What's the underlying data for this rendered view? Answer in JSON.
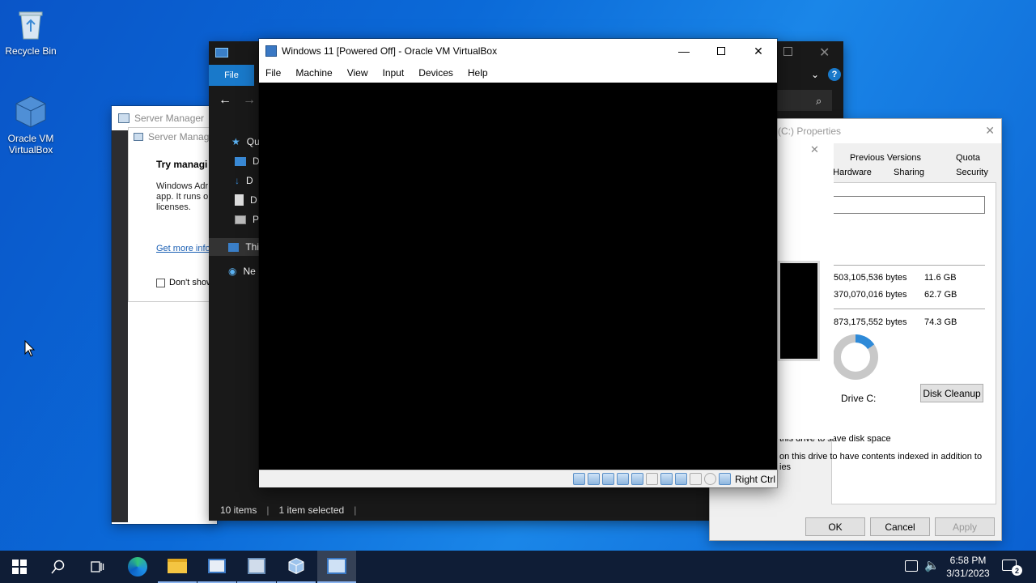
{
  "desktop": {
    "icons": [
      {
        "label": "Recycle Bin"
      },
      {
        "label": "Oracle VM VirtualBox"
      }
    ]
  },
  "server_manager": {
    "title": "Server Manager",
    "dialog_title": "Server Manage",
    "heading": "Try managi",
    "body": "Windows Adr app. It runs o licenses.",
    "link": "Get more info",
    "checkbox_label": "Don't show"
  },
  "explorer": {
    "file_tab": "File",
    "nav": [
      "Qu",
      "D",
      "D",
      "D",
      "Pi",
      "Thi",
      "Ne"
    ],
    "status_items": "10 items",
    "status_selected": "1 item selected"
  },
  "properties": {
    "title": "(C:) Properties",
    "tabs_row1": [
      "Previous Versions",
      "Quota"
    ],
    "tabs_row2": [
      "Hardware",
      "Sharing",
      "Security"
    ],
    "used_bytes": "503,105,536 bytes",
    "used_gb": "11.6 GB",
    "free_bytes": "370,070,016 bytes",
    "free_gb": "62.7 GB",
    "capacity_bytes": "873,175,552 bytes",
    "capacity_gb": "74.3 GB",
    "drive_label": "Drive C:",
    "disk_cleanup": "Disk Cleanup",
    "compress_text": "this drive to save disk space",
    "index_text": "on this drive to have contents indexed in addition to",
    "index_text2": "ies",
    "ok": "OK",
    "cancel": "Cancel",
    "apply": "Apply"
  },
  "vbox": {
    "title": "Windows 11 [Powered Off] - Oracle VM VirtualBox",
    "menu": [
      "File",
      "Machine",
      "View",
      "Input",
      "Devices",
      "Help"
    ],
    "host_key": "Right Ctrl"
  },
  "taskbar": {
    "time": "6:58 PM",
    "date": "3/31/2023",
    "notification_count": "2"
  }
}
